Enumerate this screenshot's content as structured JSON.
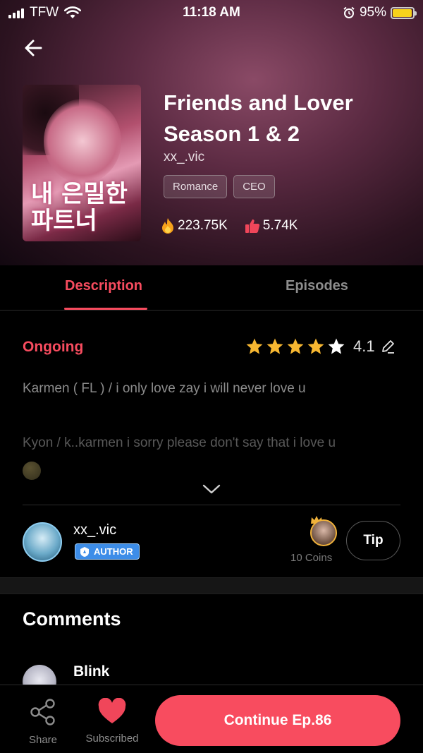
{
  "status_bar": {
    "carrier": "TFW",
    "time": "11:18 AM",
    "battery": "95%",
    "battery_level": 0.95
  },
  "book": {
    "title": "Friends and Lover Season 1 & 2",
    "author": "xx_.vic",
    "tags": [
      "Romance",
      "CEO"
    ],
    "views": "223.75K",
    "likes": "5.74K",
    "cover_text": "내 은밀한 파트너"
  },
  "tabs": {
    "description": "Description",
    "episodes": "Episodes"
  },
  "details": {
    "status": "Ongoing",
    "rating": "4.1",
    "stars_filled": 4,
    "stars_total": 5,
    "description_line1": "Karmen ( FL ) / i only love zay i will never love u",
    "description_line2": "Kyon / k..karmen i sorry please don't say that i love u"
  },
  "author_section": {
    "name": "xx_.vic",
    "badge": "AUTHOR",
    "coins": "10 Coins",
    "tip_label": "Tip"
  },
  "comments": {
    "title": "Comments",
    "first_commenter": "Blink"
  },
  "bottom_bar": {
    "share_label": "Share",
    "subscribed_label": "Subscribed",
    "continue_label": "Continue Ep.86"
  },
  "colors": {
    "accent": "#f84c5f",
    "star": "#f7b731",
    "badge": "#3d8de8"
  }
}
